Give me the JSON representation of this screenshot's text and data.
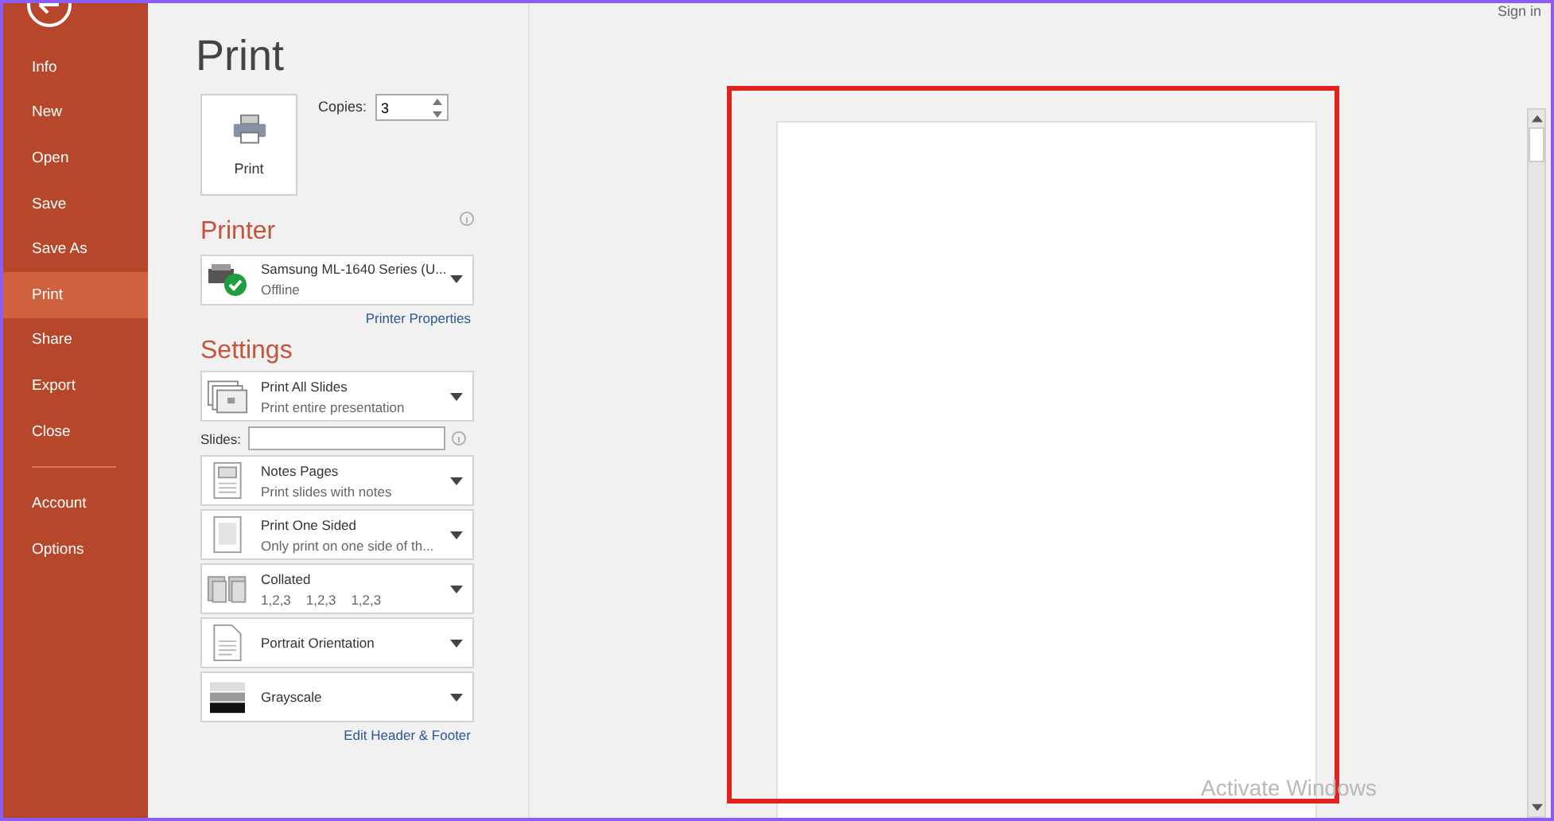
{
  "sidebar": {
    "items": [
      {
        "label": "Info",
        "selected": false
      },
      {
        "label": "New",
        "selected": false
      },
      {
        "label": "Open",
        "selected": false
      },
      {
        "label": "Save",
        "selected": false
      },
      {
        "label": "Save As",
        "selected": false
      },
      {
        "label": "Print",
        "selected": true
      },
      {
        "label": "Share",
        "selected": false
      },
      {
        "label": "Export",
        "selected": false
      },
      {
        "label": "Close",
        "selected": false
      }
    ],
    "bottom_items": [
      {
        "label": "Account",
        "selected": false
      },
      {
        "label": "Options",
        "selected": false
      }
    ]
  },
  "title": "Print",
  "print_button": {
    "label": "Print"
  },
  "copies": {
    "label": "Copies:",
    "value": "3"
  },
  "printer": {
    "heading": "Printer",
    "name": "Samsung ML-1640 Series (U...",
    "status": "Offline",
    "properties_link": "Printer Properties"
  },
  "settings": {
    "heading": "Settings",
    "slides_label": "Slides:",
    "options": [
      {
        "kind": "slides",
        "title": "Print All Slides",
        "subtitle": "Print entire presentation"
      },
      {
        "kind": "notes",
        "title": "Notes Pages",
        "subtitle": "Print slides with notes"
      },
      {
        "kind": "sided",
        "title": "Print One Sided",
        "subtitle": "Only print on one side of th..."
      },
      {
        "kind": "collated",
        "title": "Collated",
        "subtitle": "1,2,3    1,2,3    1,2,3"
      },
      {
        "kind": "orientation",
        "title": "Portrait Orientation"
      },
      {
        "kind": "color",
        "title": "Grayscale"
      }
    ],
    "footer_link": "Edit Header & Footer"
  },
  "sign_in": "Sign in",
  "activation_notice": "Activate Windows"
}
